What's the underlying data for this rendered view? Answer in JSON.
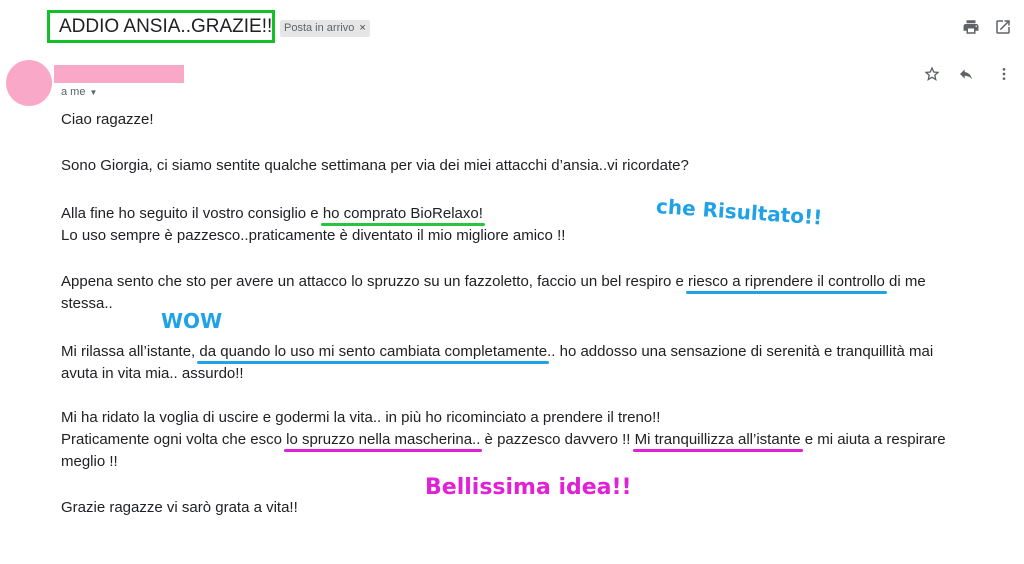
{
  "email": {
    "subject": "ADDIO ANSIA..GRAZIE!!",
    "label": "Posta in arrivo",
    "label_close": "×",
    "recipient": "a me",
    "body": {
      "l1": "Ciao ragazze!",
      "l2": "Sono Giorgia, ci siamo sentite qualche settimana per via dei miei attacchi d’ansia..vi ricordate?",
      "l3a": "Alla fine ho seguito il vostro consiglio e ",
      "l3b": "ho comprato BioRelaxo!",
      "l4": "Lo uso sempre è pazzesco..praticamente è diventato il mio migliore amico !!",
      "l5a": "Appena sento che sto per avere un attacco lo spruzzo su un fazzoletto, faccio un bel respiro e ",
      "l5b": "riesco a riprendere il controllo",
      "l5c": " di me",
      "l6": "stessa..",
      "l7a": "Mi rilassa all’istante, ",
      "l7b": "da quando lo uso mi sento cambiata completamente",
      "l7c": ".. ho addosso una sensazione di serenità e tranquillità mai",
      "l8": "avuta in vita mia.. assurdo!!",
      "l9": "Mi ha ridato la voglia di uscire e godermi la vita.. in più ho ricominciato a prendere il treno!!",
      "l10a": "Praticamente ogni volta che esco ",
      "l10b": "lo spruzzo nella mascherina..",
      "l10c": " è pazzesco davvero !! ",
      "l10d": "Mi tranquillizza all’istante",
      "l10e": " e mi aiuta a respirare",
      "l11": "meglio !!",
      "l12": "Grazie ragazze vi sarò grata a vita!!"
    }
  },
  "annotations": {
    "risultato": "che Risultato!!",
    "wow": "WOW",
    "idea": "Bellissima idea!!"
  },
  "icons": {
    "print": "print-icon",
    "open_new_window": "open-in-new-icon",
    "star": "star-icon",
    "reply": "reply-icon",
    "more": "more-vert-icon",
    "dropdown": "chevron-down-icon"
  },
  "colors": {
    "subject_highlight": "#13c127",
    "underline_green": "#28c440",
    "underline_blue": "#1fa2e6",
    "underline_magenta": "#e021d6",
    "annotation_blue": "#1fa2e6",
    "annotation_magenta": "#e021d6",
    "avatar_redacted": "#f9a9c7"
  }
}
